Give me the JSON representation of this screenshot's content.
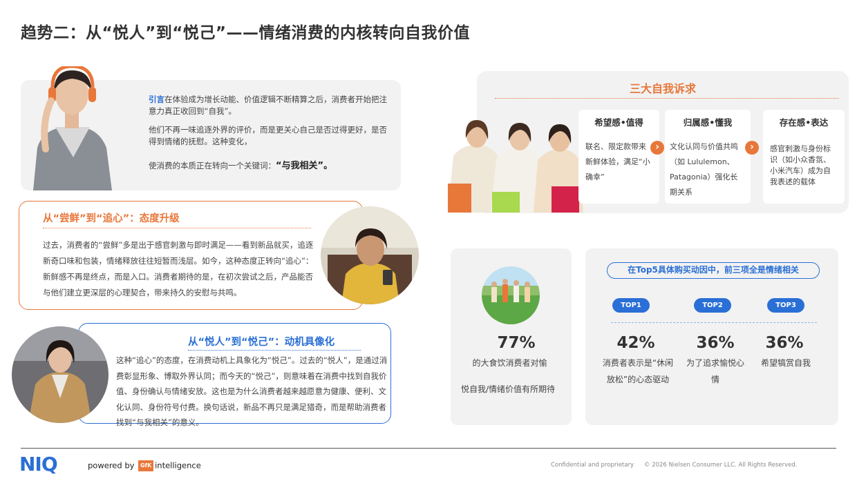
{
  "title": "趋势二：从“悦人”到“悦己”——情绪消费的内核转向自我价值",
  "intro": {
    "lead": "引言",
    "p1": "在体验成为增长动能、价值逻辑不断精算之后，消费者开始把注意力真正收回到“自我”。",
    "p2": "他们不再一味追逐外界的评价，而是更关心自己是否过得更好，是否得到情绪的抚慰。这种变化，",
    "p3_prefix": "使消费的本质正在转向一个关键词：",
    "p3_keyword": "“与我相关”。"
  },
  "section1": {
    "title": "从“尝鲜”到“追心”：态度升级",
    "body": "过去，消费者的“尝鲜”多是出于感官刺激与即时满足——看到新品就买，追逐新奇口味和包装，情绪释放往往短暂而浅层。如今，这种态度正转向“追心”：新鲜感不再是终点，而是入口。消费者期待的是，在初次尝试之后，产品能否与他们建立更深层的心理契合，带来持久的安慰与共鸣。"
  },
  "section2": {
    "title": "从“悦人”到“悦己”：动机具像化",
    "body": "这种“追心”的态度，在消费动机上具象化为“悦己”。过去的“悦人”，是通过消费彰显形象、博取外界认同；而今天的“悦己”，则意味着在消费中找到自我价值、身份确认与情绪安放。这也是为什么消费者越来越愿意为健康、便利、文化认同、身份符号付费。换句话说，新品不再只是满足猎奇，而是帮助消费者找到“与我相关”的意义。"
  },
  "demands": {
    "title": "三大自我诉求",
    "cards": [
      {
        "head": "希望感•值得",
        "body": "联名、限定款带来新鲜体验，满足“小确幸”"
      },
      {
        "head": "归属感•懂我",
        "body": "文化认同与价值共鸣（如 Lululemon、Patagonia）强化长期关系"
      },
      {
        "head": "存在感•表达",
        "body": "感官刺激与身份标识（如小众香氛、小米汽车）成为自我表述的载体"
      }
    ],
    "arrow": "›"
  },
  "stat_main": {
    "pct": "77%",
    "label1": "的大食饮消费者对愉",
    "label2": "悦自我/情绪价值有所期待"
  },
  "top5": {
    "title": "在Top5具体购买动因中，前三项全是情绪相关",
    "items": [
      {
        "badge": "TOP1",
        "pct": "42%",
        "label": "消费者表示是“休闲放松”的心态驱动"
      },
      {
        "badge": "TOP2",
        "pct": "36%",
        "label": "为了追求愉悦心情"
      },
      {
        "badge": "TOP3",
        "pct": "36%",
        "label": "希望犒赏自我"
      }
    ]
  },
  "footer": {
    "logo": "NIQ",
    "powered_by": "powered by",
    "gfk": "GfK",
    "intelligence": "intelligence",
    "confidential": "Confidential and proprietary",
    "copyright": "© 2026 Nielsen Consumer LLC. All Rights Reserved."
  },
  "colors": {
    "orange": "#e8773a",
    "blue": "#2a6fd6",
    "panel": "#f2f2f2"
  }
}
